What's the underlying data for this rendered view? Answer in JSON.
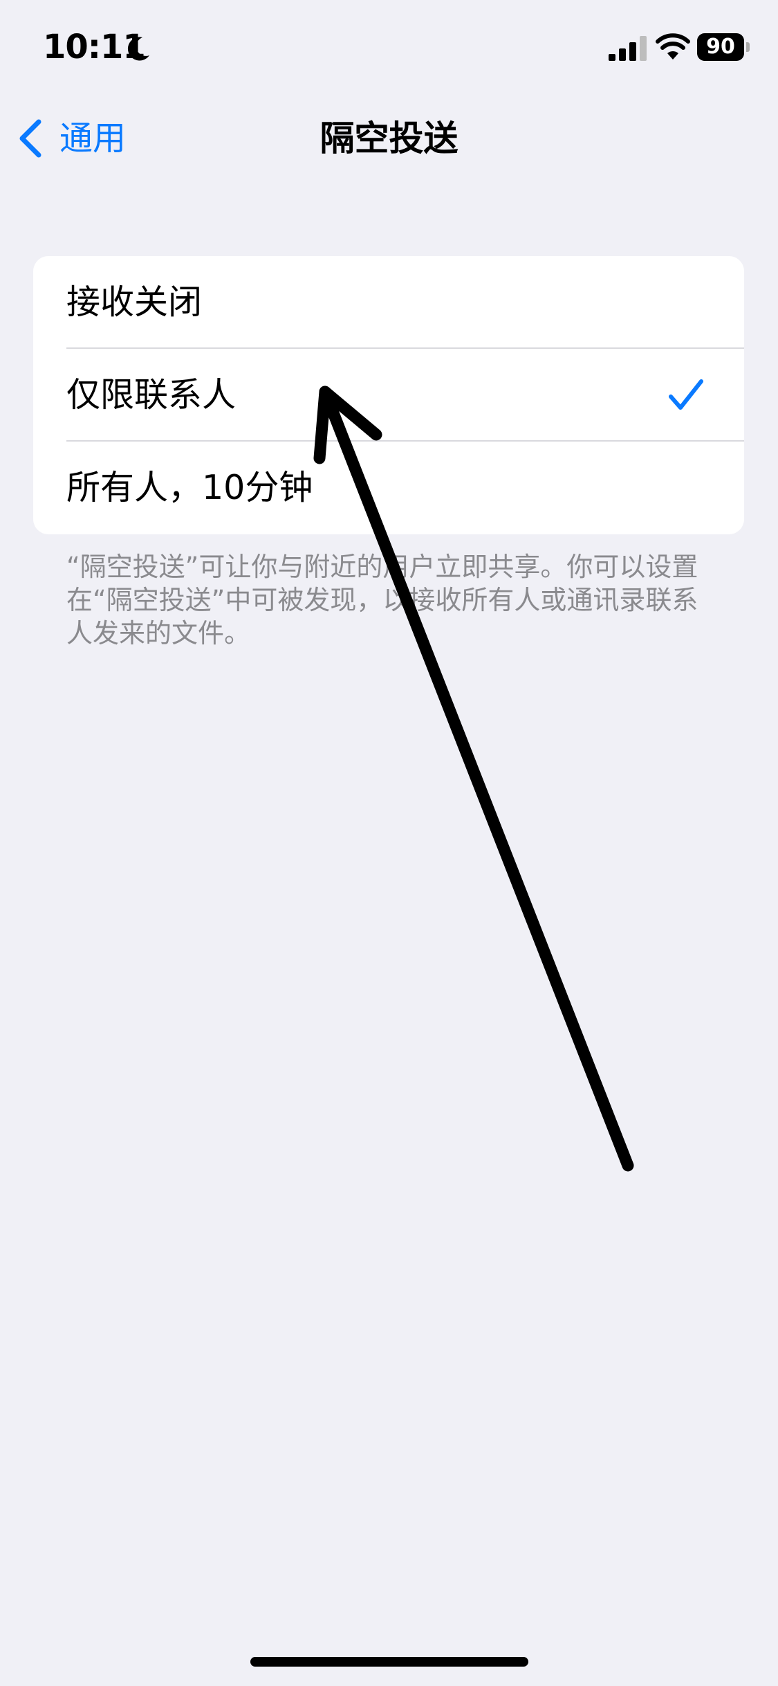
{
  "status_bar": {
    "time": "10:11",
    "battery_level": "90",
    "icons": [
      "moon-icon",
      "signal-icon",
      "wifi-icon",
      "battery-icon"
    ]
  },
  "nav": {
    "back_label": "通用",
    "title": "隔空投送"
  },
  "options": [
    {
      "label": "接收关闭",
      "selected": false
    },
    {
      "label": "仅限联系人",
      "selected": true
    },
    {
      "label": "所有人，10分钟",
      "selected": false
    }
  ],
  "footer": {
    "description": "“隔空投送”可让你与附近的用户立即共享。你可以设置在“隔空投送”中可被发现，以接收所有人或通讯录联系人发来的文件。"
  },
  "colors": {
    "accent": "#0a7aff",
    "background": "#f0f0f6",
    "card": "#ffffff",
    "footer_text": "#8a8a8e"
  }
}
